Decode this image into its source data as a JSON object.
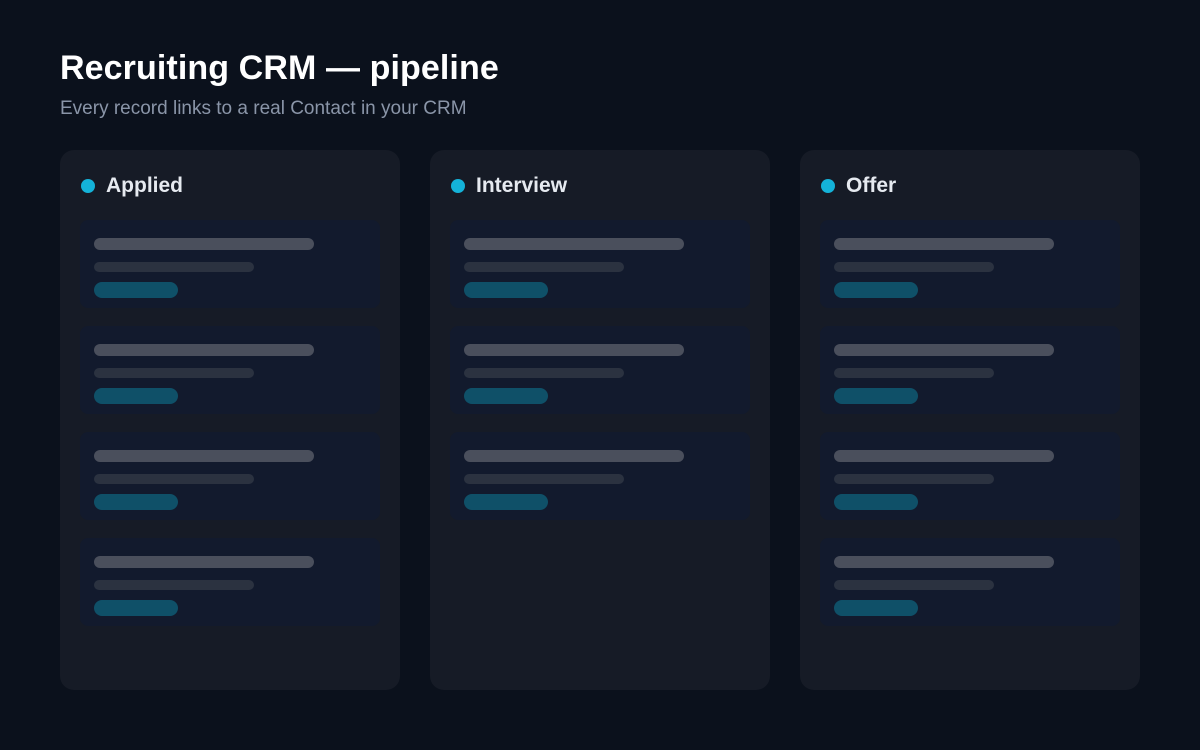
{
  "header": {
    "title": "Recruiting CRM — pipeline",
    "subtitle": "Every record links to a real Contact in your CRM"
  },
  "colors": {
    "accent": "#14b3d9",
    "background": "#0b111c",
    "column": "#161b26",
    "card": "#121a2d",
    "tag": "#0f5068"
  },
  "columns": [
    {
      "id": "applied",
      "title": "Applied",
      "card_count": 4
    },
    {
      "id": "interview",
      "title": "Interview",
      "card_count": 3
    },
    {
      "id": "offer",
      "title": "Offer",
      "card_count": 4
    }
  ]
}
